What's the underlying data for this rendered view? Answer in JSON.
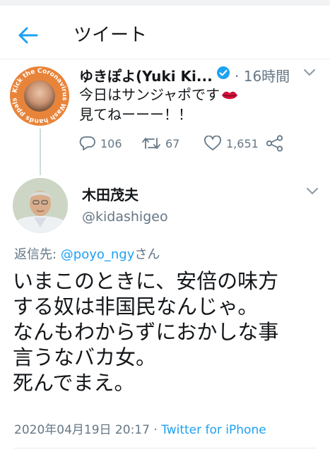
{
  "header": {
    "title": "ツイート",
    "back_icon": "arrow-left-icon"
  },
  "parent_tweet": {
    "display_name": "ゆきぽよ(Yuki Ki...",
    "verified_icon": "verified-badge-icon",
    "time": "· 16時間",
    "text_line1": "今日はサンジャポです",
    "text_line2": "見てねーーー！！",
    "emoji_icon": "lips-emoji-icon",
    "avatar_ring_text": "Kick the Coronavirus Wash hands ppalsd",
    "replies": "106",
    "retweets": "67",
    "likes": "1,651"
  },
  "reply_tweet": {
    "display_name": "木田茂夫",
    "handle": "@kidashigeo",
    "replying_label": "返信先: ",
    "replying_mention": "@poyo_ngy",
    "replying_suffix": "さん",
    "text": "いまこのときに、安倍の味方\nする奴は非国民なんじゃ。\nなんもわからずにおかしな事\n言うなバカ女。\n死んでまえ。",
    "timestamp": "2020年04月19日 20:17 · ",
    "source": "Twitter for iPhone"
  },
  "colors": {
    "accent": "#1da1f2",
    "secondary_text": "#657786",
    "primary_text": "#14171a",
    "avatar_ring": "#e8843a",
    "lips": "#d0103a"
  }
}
